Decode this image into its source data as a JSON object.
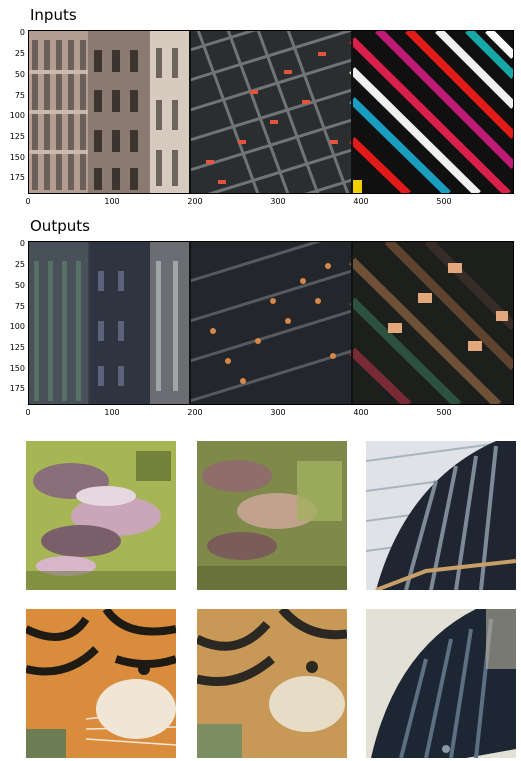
{
  "figure": {
    "inputs_title": "Inputs",
    "outputs_title": "Outputs",
    "y_ticks": [
      "0",
      "25",
      "50",
      "75",
      "100",
      "125",
      "150",
      "175"
    ],
    "x_ticks": [
      "0",
      "100",
      "200",
      "300",
      "400",
      "500"
    ]
  },
  "tiles": [
    {
      "name": "mushroom-input",
      "colors": [
        "#a7b655",
        "#8a6f7a",
        "#c9a6b8",
        "#5d6b2f",
        "#e7d7e0"
      ]
    },
    {
      "name": "mushroom-output",
      "colors": [
        "#7f8a4a",
        "#8f6d6a",
        "#c0a28d",
        "#5b6232",
        "#a3b062"
      ]
    },
    {
      "name": "building-output-1",
      "colors": [
        "#dfe2e6",
        "#202631",
        "#7f8a98",
        "#c8a067",
        "#aab4bf"
      ]
    },
    {
      "name": "tiger-input",
      "colors": [
        "#d98c3c",
        "#1e1a14",
        "#f1e6d6",
        "#b86f2c",
        "#6c7d53"
      ]
    },
    {
      "name": "tiger-output",
      "colors": [
        "#c79856",
        "#2b2722",
        "#e7dcc6",
        "#a57a45",
        "#7c8f62"
      ]
    },
    {
      "name": "building-output-2",
      "colors": [
        "#e3e0d5",
        "#1d2733",
        "#5c6f83",
        "#b5b19e",
        "#8a98a3"
      ]
    }
  ]
}
